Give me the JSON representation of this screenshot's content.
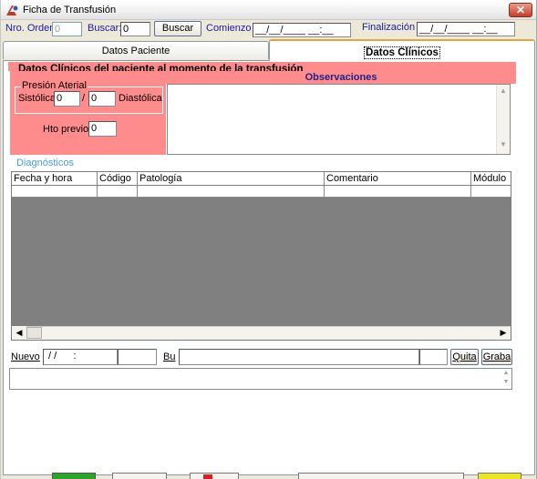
{
  "window": {
    "title": "Ficha de Transfusión",
    "close_glyph": "✕"
  },
  "toolbar": {
    "nro_orden_label": "Nro. Orden:",
    "nro_orden_value": "0",
    "buscar_label": "Buscar:",
    "buscar_value": "0",
    "buscar_button": "Buscar",
    "comienzo_label": "Comienzo",
    "comienzo_value": "__/__/____ __:__",
    "finalizacion_label": "Finalización",
    "finalizacion_value": "__/__/____ __:__"
  },
  "tabs": [
    {
      "label": "Datos Paciente",
      "active": false
    },
    {
      "label": "Datos Clínicos",
      "active": true
    }
  ],
  "clinical": {
    "section_title": "Datos Clínicos del paciente al momento de la transfusión",
    "presion_label": "Presión Aterial",
    "sistolica_label": "Sistólica",
    "sistolica_value": "0",
    "separator": "/",
    "diastolica_value": "0",
    "diastolica_label": "Diastólica",
    "hto_label": "Hto previo:",
    "hto_value": "0",
    "observaciones_title": "Observaciones"
  },
  "diagnosticos": {
    "label": "Diagnósticos",
    "columns": [
      "Fecha y hora",
      "Código",
      "Patología",
      "Comentario",
      "Módulo"
    ]
  },
  "entry_row": {
    "nuevo_label": "Nuevo",
    "date_value": " / /      :",
    "bu_label": "Bu",
    "quita_label": "Quita",
    "graba_label": "Graba"
  },
  "colors": {
    "accent_pink": "#ff8c8c",
    "label_blue": "#1a1aa6",
    "diag_blue": "#4a9cd9",
    "grid_gray": "#808080"
  }
}
